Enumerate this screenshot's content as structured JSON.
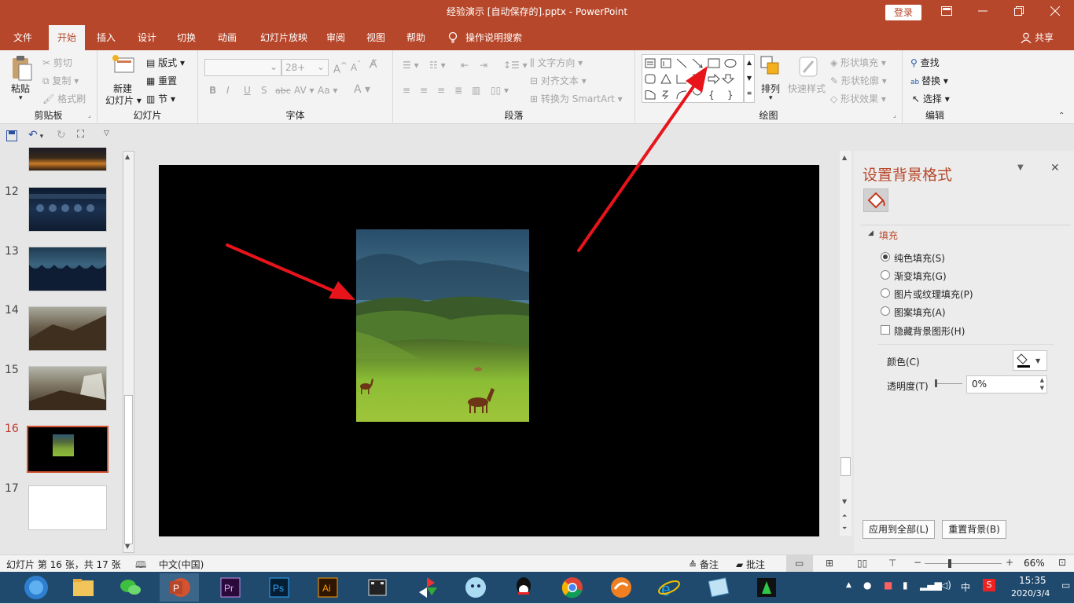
{
  "window": {
    "title": "经验演示 [自动保存的].pptx  -  PowerPoint",
    "login": "登录"
  },
  "tabs": [
    "文件",
    "开始",
    "插入",
    "设计",
    "切换",
    "动画",
    "幻灯片放映",
    "审阅",
    "视图",
    "帮助"
  ],
  "tell_me": "操作说明搜索",
  "share": "共享",
  "ribbon": {
    "clipboard": {
      "paste": "粘贴",
      "cut": "剪切",
      "copy": "复制",
      "format_painter": "格式刷",
      "label": "剪贴板"
    },
    "slides": {
      "new_slide_line1": "新建",
      "new_slide_line2": "幻灯片",
      "layout": "版式",
      "reset": "重置",
      "section": "节",
      "label": "幻灯片"
    },
    "font": {
      "size": "28+",
      "label": "字体"
    },
    "paragraph": {
      "text_direction": "文字方向",
      "align_text": "对齐文本",
      "smartart": "转换为 SmartArt",
      "label": "段落"
    },
    "drawing": {
      "arrange": "排列",
      "quick_styles": "快速样式",
      "shape_fill": "形状填充",
      "shape_outline": "形状轮廓",
      "shape_effects": "形状效果",
      "label": "绘图"
    },
    "editing": {
      "find": "查找",
      "replace": "替换",
      "select": "选择",
      "label": "编辑"
    }
  },
  "thumbnails": {
    "numbers": [
      "12",
      "13",
      "14",
      "15",
      "16",
      "17"
    ],
    "selected": "16"
  },
  "format_pane": {
    "title": "设置背景格式",
    "section": "填充",
    "options": [
      "纯色填充(S)",
      "渐变填充(G)",
      "图片或纹理填充(P)",
      "图案填充(A)"
    ],
    "selected_option": "纯色填充(S)",
    "hide_bg": "隐藏背景图形(H)",
    "color_label": "颜色(C)",
    "transparency_label": "透明度(T)",
    "transparency_value": "0%",
    "apply_all": "应用到全部(L)",
    "reset_bg": "重置背景(B)"
  },
  "status": {
    "slide_info": "幻灯片 第 16 张，共 17 张",
    "language": "中文(中国)",
    "notes": "备注",
    "comments": "批注",
    "zoom": "66%"
  },
  "taskbar": {
    "time": "15:35",
    "date": "2020/3/4",
    "ime": "中"
  },
  "colors": {
    "accent": "#b7472a",
    "slide_bg": "#000000",
    "arrow": "#e8141b"
  }
}
